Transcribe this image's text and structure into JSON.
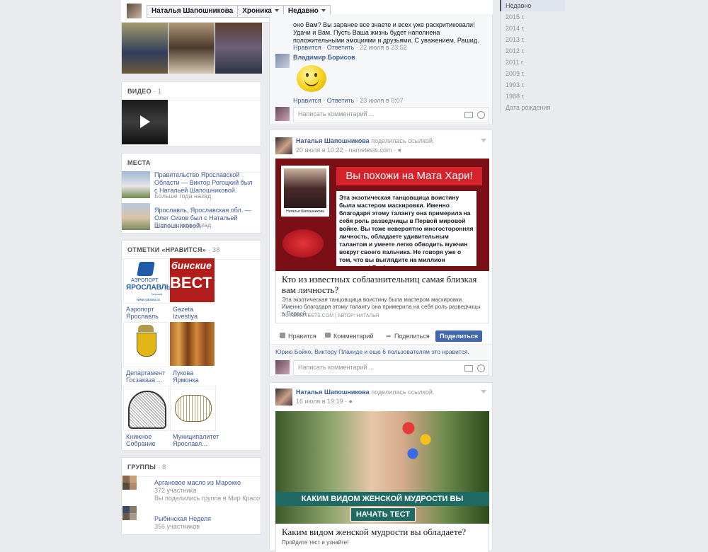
{
  "topbar": {
    "name": "Наталья Шапошникова",
    "tab_timeline": "Хроника",
    "tab_recent": "Недавно"
  },
  "years": [
    "Недавно",
    "2015 г.",
    "2014 г.",
    "2013 г.",
    "2012 г.",
    "2011 г.",
    "2009 г.",
    "1993 г.",
    "1988 г.",
    "Дата рождения"
  ],
  "video": {
    "title": "ВИДЕО",
    "count": "1"
  },
  "places": {
    "title": "МЕСТА",
    "items": [
      {
        "text": "Правительство Ярославской Области — Виктор Рогоцкий был с Натальей Шапошниковой.",
        "time": "Больше года назад"
      },
      {
        "text": "Ярославль, Ярославская обл. — Олег Сизов был с Натальей Шапошниковой.",
        "time": "Больше года назад"
      }
    ]
  },
  "likes": {
    "title": "ОТМЕТКИ «НРАВИТСЯ»",
    "count": "38",
    "items": [
      {
        "label": "Аэропорт Ярославль",
        "logo_top": "АЭРОПОРТ",
        "logo_bottom": "ЯРОСЛАВЛЬ",
        "logo_tiny": "Туношна",
        "logo_url": "www.yarava.ru"
      },
      {
        "label": "Gazeta Izvestiya",
        "logo_top": "бинские",
        "logo_bottom": "ВЕСТ"
      },
      {
        "label": "Департамент Госзаказа ..."
      },
      {
        "label": "Лукова Ярмонка"
      },
      {
        "label": "Книжное Собрание"
      },
      {
        "label": "Муниципалитет Ярославл..."
      }
    ]
  },
  "groups": {
    "title": "ГРУППЫ",
    "count": "8",
    "items": [
      {
        "name": "Аргановое масло из Марокко",
        "members": "372 участника",
        "extra": "Вы поделились группа в Мир Красоты и ..."
      },
      {
        "name": "Рыбинская Неделя",
        "members": "356 участников"
      }
    ]
  },
  "post_top": {
    "comment_text": "оно Вам? Вы заранее все знаете и всех уже раскритиковали! Удачи и Вам. Пусть Ваша жизнь будет наполнена положительными эмоциями и друзьями. С уважением, Рашид.",
    "comment1_meta": {
      "like": "Нравится",
      "reply": "Ответить",
      "time": "22 июля в 23:52"
    },
    "commenter2": "Владимир Борисов",
    "comment2_meta": {
      "like": "Нравится",
      "reply": "Ответить",
      "time": "23 июля в 0:07"
    },
    "input_placeholder": "Написать комментарий ..."
  },
  "post1": {
    "author": "Наталья Шапошникова",
    "action": "поделилась ссылкой.",
    "time": "20 июля в 10:22",
    "site": "nametests.com",
    "banner_title": "Вы похожи на Мата Хари!",
    "banner_caption": "Наталья Шапошникова",
    "banner_text": "Эта экзотическая танцовщица воистину была мастером маскировки. Именно благодаря этому таланту она примерила на себя роль разведчицы в Первой мировой войне. Вы тоже невероятно многосторонняя личность, обладаете удивительным талантом и умеете легко обводить мужчин вокруг своего пальчика. Не говоря уже о том, что вы выглядите на миллион долларов! Вау!",
    "link_title": "Кто из известных соблазнительниц самая близкая вам личность?",
    "link_desc": "Эта экзотическая танцовщица воистину была мастером маскировки. Именно благодаря этому таланту она примерила на себя роль разведчицы в Первой ...",
    "link_source": "RU.NAMETESTS.COM | АВТОР: НАТАЛЬЯ",
    "actions": {
      "like": "Нравится",
      "comment": "Комментарий",
      "share": "Поделиться",
      "share_btn": "Поделиться"
    },
    "likes_text": "Юрию Бойко, Виктору Плакиде и еще 6 пользователям это нравится.",
    "input_placeholder": "Написать комментарий ..."
  },
  "post2": {
    "author": "Наталья Шапошникова",
    "action": "поделилась ссылкой.",
    "time": "16 июля в 19:19",
    "banner_text": "КАКИМ ВИДОМ ЖЕНСКОЙ МУДРОСТИ ВЫ ОБЛАДАЕТЕ?",
    "banner_btn": "НАЧАТЬ ТЕСТ",
    "link_title": "Каким видом женской мудрости вы обладаете?",
    "link_desc": "Пройдите тест и узнайте!"
  },
  "colors": {
    "brand": "#3b5998",
    "banner_red": "#b0141b",
    "banner_bg": "#7a1016",
    "teal": "#1f6b63"
  }
}
